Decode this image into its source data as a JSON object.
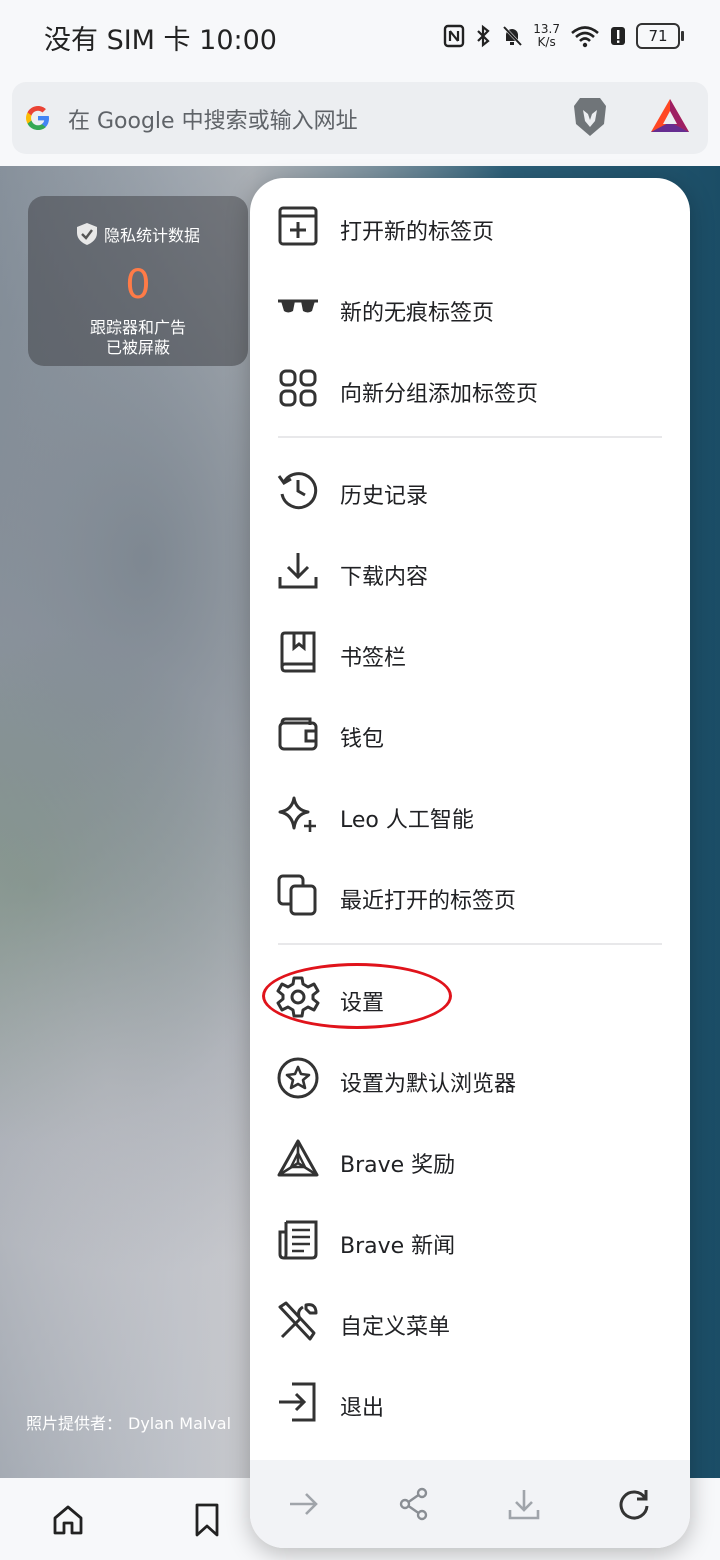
{
  "status": {
    "carrier_time": "没有 SIM 卡 10:00",
    "net_speed_value": "13.7",
    "net_speed_unit": "K/s",
    "battery": "71"
  },
  "address_bar": {
    "placeholder": "在 Google 中搜索或输入网址"
  },
  "privacy_stats": {
    "title": "隐私统计数据",
    "count": "0",
    "desc_line1": "跟踪器和广告",
    "desc_line2": "已被屏蔽"
  },
  "photo_credit": {
    "label": "照片提供者：",
    "name": "Dylan Malval"
  },
  "menu": {
    "items": [
      {
        "label": "打开新的标签页",
        "icon": "new-tab-icon"
      },
      {
        "label": "新的无痕标签页",
        "icon": "incognito-glasses-icon"
      },
      {
        "label": "向新分组添加标签页",
        "icon": "tab-group-icon"
      },
      {
        "label": "历史记录",
        "icon": "history-icon"
      },
      {
        "label": "下载内容",
        "icon": "download-icon"
      },
      {
        "label": "书签栏",
        "icon": "bookmarks-icon"
      },
      {
        "label": "钱包",
        "icon": "wallet-icon"
      },
      {
        "label": "Leo 人工智能",
        "icon": "sparkle-icon"
      },
      {
        "label": "最近打开的标签页",
        "icon": "recent-tabs-icon"
      },
      {
        "label": "设置",
        "icon": "gear-icon"
      },
      {
        "label": "设置为默认浏览器",
        "icon": "star-circle-icon"
      },
      {
        "label": "Brave 奖励",
        "icon": "rewards-triangle-icon"
      },
      {
        "label": "Brave 新闻",
        "icon": "news-icon"
      },
      {
        "label": "自定义菜单",
        "icon": "tools-icon"
      },
      {
        "label": "退出",
        "icon": "exit-icon"
      }
    ]
  },
  "colors": {
    "accent_orange": "#ff7b47",
    "highlight_red": "#e0131b"
  }
}
